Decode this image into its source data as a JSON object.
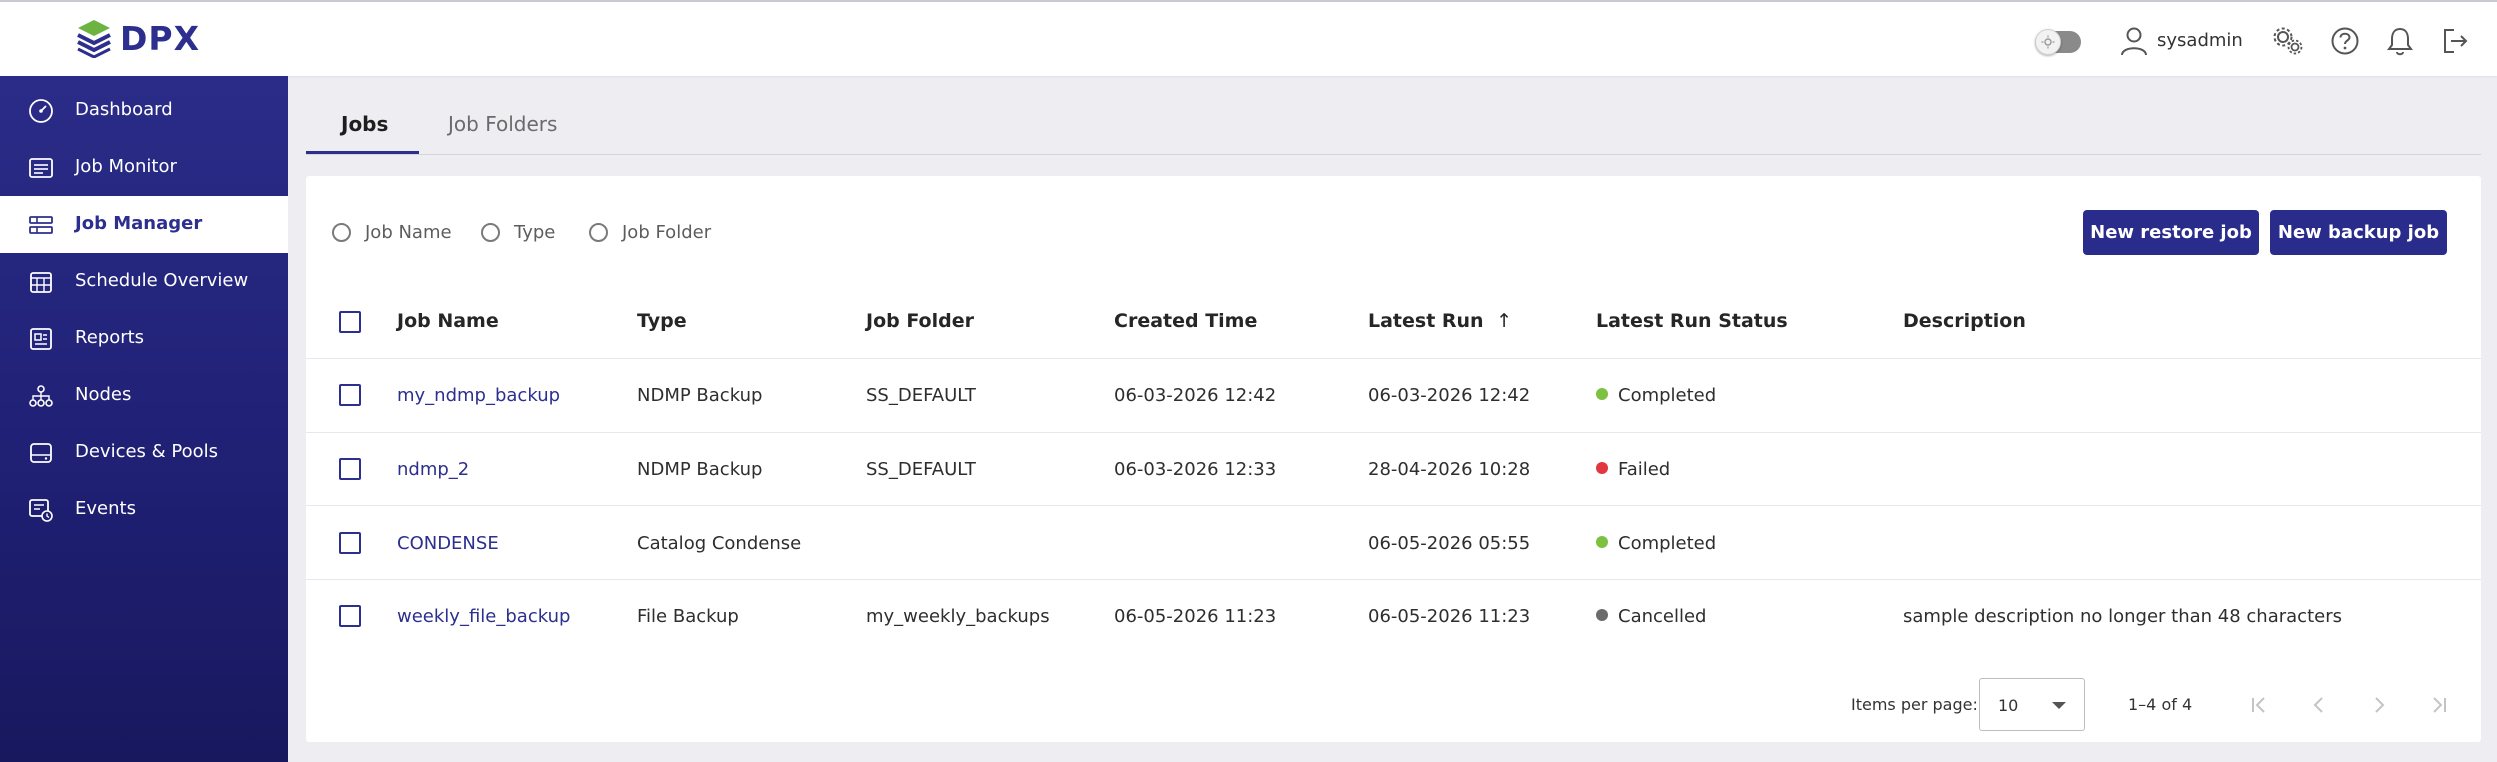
{
  "brand": {
    "logo_text": "DPX",
    "logo_colors": [
      "#2d2f8e",
      "#6cb33f"
    ]
  },
  "header": {
    "username": "sysadmin",
    "icons": [
      "theme-toggle",
      "user-icon",
      "settings-gears-icon",
      "help-icon",
      "bell-icon",
      "logout-icon"
    ]
  },
  "sidebar": {
    "items": [
      {
        "label": "Dashboard",
        "icon": "dashboard-gauge-icon"
      },
      {
        "label": "Job Monitor",
        "icon": "job-monitor-icon"
      },
      {
        "label": "Job Manager",
        "icon": "job-manager-icon",
        "active": true
      },
      {
        "label": "Schedule Overview",
        "icon": "calendar-icon"
      },
      {
        "label": "Reports",
        "icon": "reports-icon"
      },
      {
        "label": "Nodes",
        "icon": "nodes-icon"
      },
      {
        "label": "Devices & Pools",
        "icon": "devices-icon"
      },
      {
        "label": "Events",
        "icon": "events-icon"
      }
    ]
  },
  "tabs": [
    {
      "label": "Jobs",
      "active": true
    },
    {
      "label": "Job Folders",
      "active": false
    }
  ],
  "filters": {
    "options": [
      "Job Name",
      "Type",
      "Job Folder"
    ]
  },
  "buttons": {
    "new_restore": "New restore job",
    "new_backup": "New backup job"
  },
  "table": {
    "columns": [
      "Job Name",
      "Type",
      "Job Folder",
      "Created Time",
      "Latest Run",
      "Latest Run Status",
      "Description"
    ],
    "sort_indicator": "↑",
    "rows": [
      {
        "name": "my_ndmp_backup",
        "type": "NDMP Backup",
        "folder": "SS_DEFAULT",
        "created": "06-03-2026 12:42",
        "latest_run": "06-03-2026 12:42",
        "status": "Completed",
        "status_color": "#7cc142",
        "description": ""
      },
      {
        "name": "ndmp_2",
        "type": "NDMP Backup",
        "folder": "SS_DEFAULT",
        "created": "06-03-2026 12:33",
        "latest_run": "28-04-2026 10:28",
        "status": "Failed",
        "status_color": "#e0383e",
        "description": ""
      },
      {
        "name": "CONDENSE",
        "type": "Catalog Condense",
        "folder": "",
        "created": "",
        "latest_run": "06-05-2026 05:55",
        "status": "Completed",
        "status_color": "#7cc142",
        "description": ""
      },
      {
        "name": "weekly_file_backup",
        "type": "File Backup",
        "folder": "my_weekly_backups",
        "created": "06-05-2026 11:23",
        "latest_run": "06-05-2026 11:23",
        "status": "Cancelled",
        "status_color": "#6b6b6b",
        "description": "sample description no longer than 48 characters"
      }
    ]
  },
  "pagination": {
    "items_per_page_label": "Items per page:",
    "items_per_page": "10",
    "range": "1–4 of 4"
  }
}
